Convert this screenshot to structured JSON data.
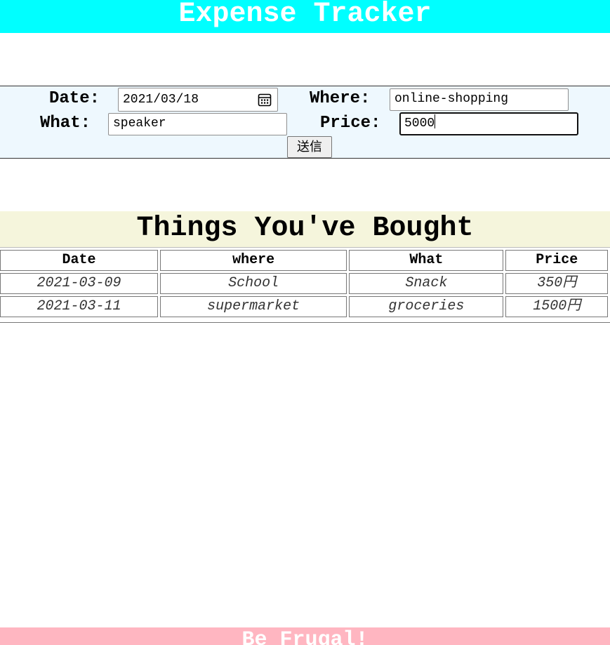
{
  "header": {
    "title": "Expense Tracker"
  },
  "form": {
    "date_label": "Date:",
    "date_value": "2021/03/18",
    "where_label": "Where:",
    "where_value": "online-shopping",
    "what_label": "What:",
    "what_value": "speaker",
    "price_label": "Price:",
    "price_value": "5000",
    "submit_label": "送信"
  },
  "things": {
    "title": "Things You've Bought",
    "columns": [
      "Date",
      "where",
      "What",
      "Price"
    ],
    "rows": [
      [
        "2021-03-09",
        "School",
        "Snack",
        "350円"
      ],
      [
        "2021-03-11",
        "supermarket",
        "groceries",
        "1500円"
      ]
    ]
  },
  "footer": {
    "text": "Be Frugal!"
  },
  "colors": {
    "header_bg": "#00ffff",
    "form_bg": "#eef8fe",
    "section_title_bg": "#f5f5dc",
    "footer_bg": "#ffb6c1"
  },
  "icons": {
    "date_picker": "calendar-icon"
  }
}
